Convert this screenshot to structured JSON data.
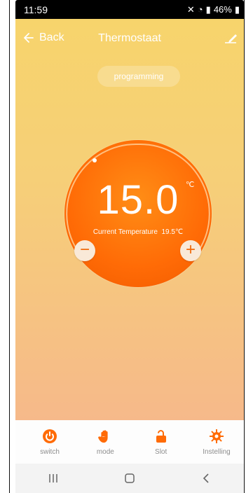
{
  "status": {
    "time": "11:59",
    "battery": "46%"
  },
  "header": {
    "back_label": "Back",
    "title": "Thermostaat"
  },
  "mode_pill": {
    "label": "programming"
  },
  "dial": {
    "setpoint": "15.0",
    "unit": "℃",
    "current_label": "Current Temperature",
    "current_value": "19.5℃"
  },
  "tabs": [
    {
      "label": "switch",
      "icon": "power-icon"
    },
    {
      "label": "mode",
      "icon": "hand-icon"
    },
    {
      "label": "Slot",
      "icon": "unlock-icon"
    },
    {
      "label": "Instelling",
      "icon": "gear-icon"
    }
  ],
  "colors": {
    "accent": "#ff6b06",
    "gradient_top": "#f7d46c",
    "gradient_bottom": "#f6b98a"
  }
}
